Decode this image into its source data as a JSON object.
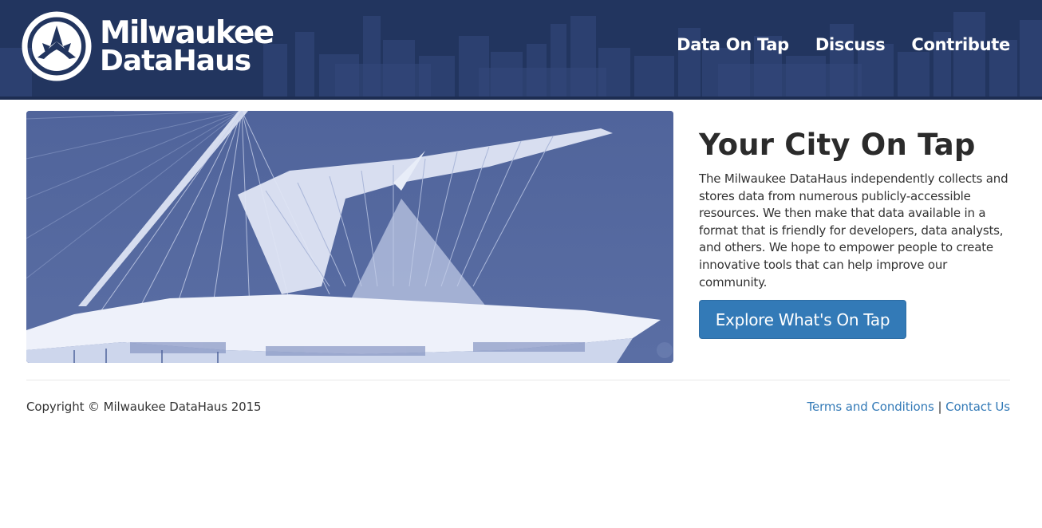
{
  "header": {
    "logo_line1": "Milwaukee",
    "logo_line2": "DataHaus",
    "nav": [
      {
        "label": "Data On Tap"
      },
      {
        "label": "Discuss"
      },
      {
        "label": "Contribute"
      }
    ]
  },
  "hero": {
    "image_icon": "art-museum-photo",
    "title": "Your City On Tap",
    "body": "The Milwaukee DataHaus independently collects and stores data from numerous publicly-accessible resources. We then make that data available in a format that is friendly for developers, data analysts, and others. We hope to empower people to create innovative tools that can help improve our community.",
    "cta_label": "Explore What's On Tap"
  },
  "footer": {
    "copyright": "Copyright © Milwaukee DataHaus 2015",
    "terms_label": "Terms and Conditions",
    "separator": "|",
    "contact_label": "Contact Us"
  },
  "colors": {
    "header_bg": "#22355f",
    "accent": "#337ab7",
    "image_tint": "#4d6198"
  }
}
